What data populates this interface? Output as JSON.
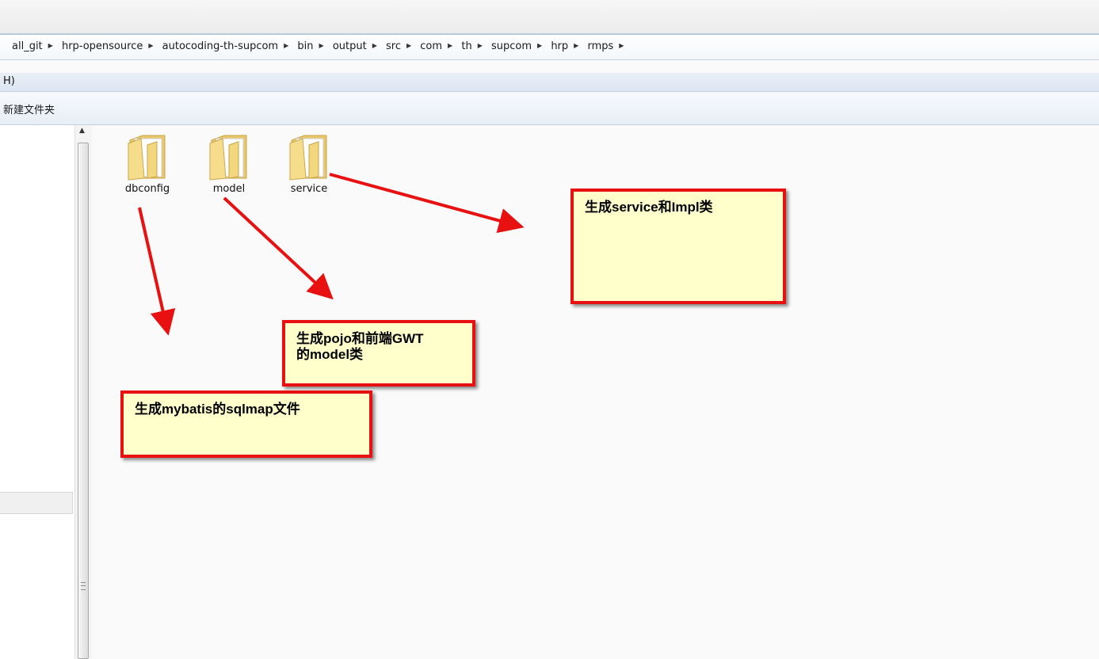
{
  "address_bar": {
    "path": [
      "all_git",
      "hrp-opensource",
      "autocoding-th-supcom",
      "bin",
      "output",
      "src",
      "com",
      "th",
      "supcom",
      "hrp",
      "rmps"
    ],
    "separator": "▸"
  },
  "menubar": {
    "partial_item": "H)"
  },
  "toolbar": {
    "new_folder_label": "新建文件夹"
  },
  "folders": [
    {
      "name": "dbconfig"
    },
    {
      "name": "model"
    },
    {
      "name": "service"
    }
  ],
  "annotations": {
    "service_note": "生成service和Impl类",
    "model_note_line1": "生成pojo和前端GWT",
    "model_note_line2": "的model类",
    "dbconfig_note": "生成mybatis的sqlmap文件"
  },
  "colors": {
    "callout_border": "#e81010",
    "callout_fill": "#ffffcc",
    "arrow": "#e81010",
    "folder": "#f2d77e"
  },
  "icons": {
    "folder": "folder-icon",
    "scroll_up": "scroll-up-arrow-icon",
    "breadcrumb_sep": "chevron-right-icon"
  }
}
